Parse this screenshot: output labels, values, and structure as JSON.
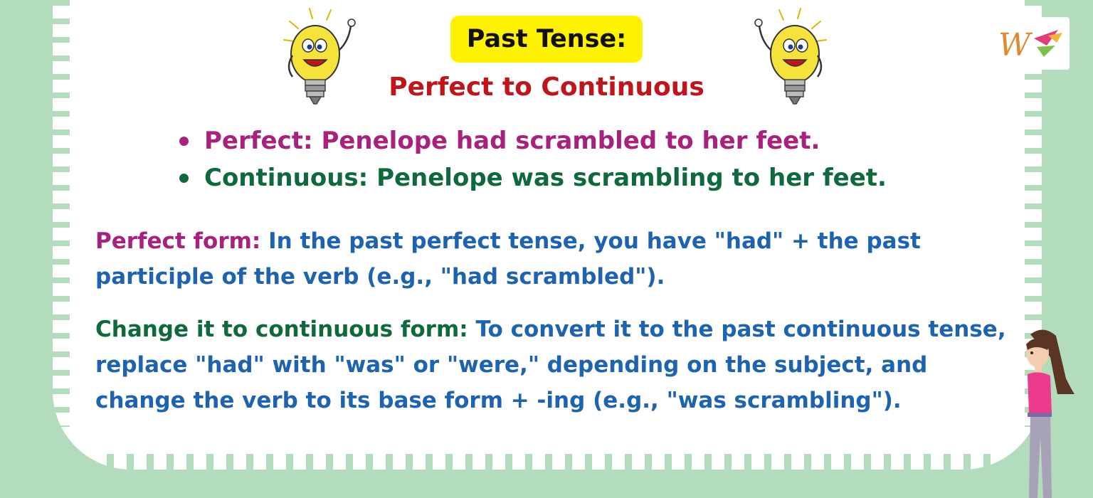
{
  "header": {
    "title": "Past Tense:",
    "subtitle": "Perfect to Continuous"
  },
  "examples": [
    {
      "text": "Perfect: Penelope had scrambled to her feet.",
      "color": "#a8217d"
    },
    {
      "text": "Continuous: Penelope was scrambling to her feet.",
      "color": "#0e6a3c"
    }
  ],
  "explanations": {
    "perfect": {
      "label": "Perfect form: ",
      "text": "In the past perfect tense, you have \"had\" + the past participle of the verb (e.g., \"had scrambled\")."
    },
    "change": {
      "label": "Change it to continuous form:",
      "text": "To convert it to the past continuous tense, replace \"had\" with \"was\" or \"were,\" depending on the subject, and change the verb to its base form + -ing (e.g., \"was scrambling\")."
    }
  },
  "colors": {
    "background": "#b3dcbc",
    "title_badge": "#fff200",
    "subtitle": "#c0151a",
    "body_text": "#1e63b0",
    "perfect": "#a8217d",
    "continuous": "#0e6a3c"
  },
  "icons": [
    "lightbulb-mascot-icon",
    "lightbulb-mascot-icon",
    "brand-logo-icon",
    "girl-illustration"
  ]
}
